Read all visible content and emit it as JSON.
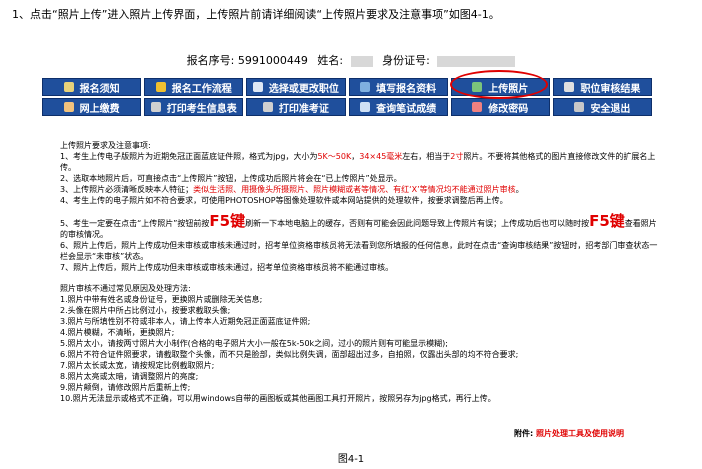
{
  "doc": {
    "intro": "1、点击“照片上传”进入照片上传界面，上传照片前请详细阅读“上传照片要求及注意事项”如图4-1。",
    "caption": "图4-1"
  },
  "info": {
    "reg_label": "报名序号:",
    "reg_value": "5991000449",
    "name_label": "姓名:",
    "id_label": "身份证号:"
  },
  "nav": {
    "row1": [
      {
        "label": "报名须知",
        "icon": "book-icon"
      },
      {
        "label": "报名工作流程",
        "icon": "workflow-icon"
      },
      {
        "label": "选择或更改职位",
        "icon": "position-icon"
      },
      {
        "label": "填写报名资料",
        "icon": "pen-icon"
      },
      {
        "label": "上传照片",
        "icon": "photo-icon"
      },
      {
        "label": "职位审核结果",
        "icon": "key-icon"
      }
    ],
    "row2": [
      {
        "label": "网上缴费",
        "icon": "user-icon"
      },
      {
        "label": "打印考生信息表",
        "icon": "print-icon"
      },
      {
        "label": "打印准考证",
        "icon": "print-icon"
      },
      {
        "label": "查询笔试成绩",
        "icon": "search-icon"
      },
      {
        "label": "修改密码",
        "icon": "password-icon"
      },
      {
        "label": "安全退出",
        "icon": "exit-icon"
      }
    ]
  },
  "content": {
    "heading": "上传照片要求及注意事项:",
    "r1a": "1、考生上传电子版照片为近期免冠正面蓝底证件照，格式为jpg，大小为",
    "r1b": "5K～50K",
    "r1c": "，",
    "r1d": "34×45毫米",
    "r1e": "左右，相当于",
    "r1f": "2寸",
    "r1g": "照片。不要将其他格式的图片直接修改文件的扩展名上传。",
    "r2": "2、选取本地照片后，可直接点击“上传照片”按钮，上传成功后照片将会在“已上传照片”处显示。",
    "r3a": "3、上传照片必须清晰反映本人特征；",
    "r3b": "类似生活照、用摄像头所摄照片、照片模糊或者等情况、有红‘X’等情况均不能通过照片审核",
    "r3c": "。",
    "r4": "4、考生上传的电子照片如不符合要求，可使用PHOTOSHOP等图像处理软件或本网站提供的处理软件，按要求调整后再上传。",
    "r5a": "5、考生一定要在点击“上传照片”按钮前按",
    "r5b": "F5键",
    "r5c": "刷新一下本地电脑上的缓存，否则有可能会因此问题导致上传照片有误；上传成功后也可以随时按",
    "r5d": "F5键",
    "r5e": "查看照片的审核情况。",
    "r6": "6、照片上传后，照片上传成功但未审核或审核未通过时，招考单位资格审核员将无法看到您所填报的任何信息，此时在点击“查询审核结果”按钮时，招考部门审查状态一栏会显示“未审核”状态。",
    "r7": "7、照片上传后，照片上传成功但未审核或审核未通过，招考单位资格审核员将不能通过审核。",
    "fail_heading": "照片审核不通过常见原因及处理方法:",
    "fail_items": [
      "1.照片中带有姓名或身份证号，更换照片或删除无关信息;",
      "2.头像在照片中所占比例过小，按要求截取头像;",
      "3.照片与所填性别不符或非本人，请上传本人近期免冠正面蓝底证件照;",
      "4.照片模糊，不清晰，更换照片;",
      "5.照片太小，请按两寸照片大小制作(合格的电子照片大小一般在5k-50k之间，过小的照片则有可能显示模糊);",
      "6.照片不符合证件照要求，请截取整个头像，而不只是脸部，类似比例失调，面部超出过多，自拍照，仅露出头部的均不符合要求;",
      "7.照片太长或太宽，请按规定比例截取照片;",
      "8.照片太亮或太暗，请调整照片的亮度;",
      "9.照片颠倒，请修改照片后重新上传;",
      "10.照片无法显示或格式不正确，可以用windows自带的画图板或其他画图工具打开照片，按照另存为jpg格式，再行上传。"
    ]
  },
  "footer": {
    "attach_label": "附件:",
    "attach_link": "照片处理工具及使用说明"
  },
  "colors": {
    "nav_bg": "#1f4f9c",
    "highlight": "#e00000",
    "warning_text": "#e00000"
  }
}
